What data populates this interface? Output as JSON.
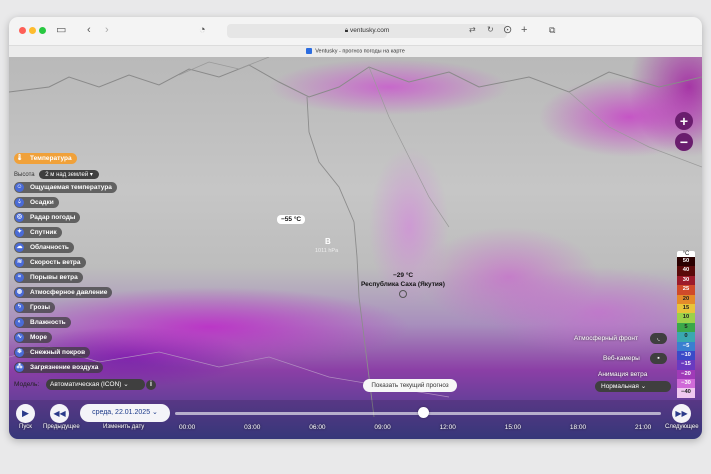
{
  "browser": {
    "address": "ventusky.com",
    "tab_title": "Ventusky - прогноз погоды на карте"
  },
  "layers": {
    "height_label": "Высота",
    "height_value": "2 м над землей",
    "items": [
      {
        "label": "Температура",
        "icon": "thermometer-icon",
        "active": true
      },
      {
        "label": "Ощущаемая температура",
        "icon": "feels-like-icon",
        "active": false
      },
      {
        "label": "Осадки",
        "icon": "drop-icon",
        "active": false
      },
      {
        "label": "Радар погоды",
        "icon": "radar-icon",
        "active": false
      },
      {
        "label": "Спутник",
        "icon": "satellite-icon",
        "active": false
      },
      {
        "label": "Облачность",
        "icon": "cloud-icon",
        "active": false
      },
      {
        "label": "Скорость ветра",
        "icon": "wind-icon",
        "active": false
      },
      {
        "label": "Порывы ветра",
        "icon": "gust-icon",
        "active": false
      },
      {
        "label": "Атмосферное давление",
        "icon": "pressure-icon",
        "active": false
      },
      {
        "label": "Грозы",
        "icon": "storm-icon",
        "active": false
      },
      {
        "label": "Влажность",
        "icon": "humidity-icon",
        "active": false
      },
      {
        "label": "Море",
        "icon": "wave-icon",
        "active": false
      },
      {
        "label": "Снежный покров",
        "icon": "snowflake-icon",
        "active": false
      },
      {
        "label": "Загрязнение воздуха",
        "icon": "pollution-icon",
        "active": false
      }
    ]
  },
  "model": {
    "label": "Модель:",
    "value": "Автоматическая (ICON)"
  },
  "map": {
    "temp_box": "−55 °C",
    "city_temp": "−29 °C",
    "region": "Республика Саха (Якутия)",
    "pressure_letter": "В",
    "pressure_value": "1011 hPa",
    "forecast_button": "Показать текущий прогноз"
  },
  "controls": {
    "fronts_label": "Атмосферный фронт",
    "webcams_label": "Веб-камеры",
    "animation_label": "Анимация ветра",
    "animation_value": "Нормальная"
  },
  "legend": {
    "unit": "°C",
    "values": [
      "50",
      "40",
      "30",
      "25",
      "20",
      "15",
      "10",
      "5",
      "0",
      "−5",
      "−10",
      "−15",
      "−20",
      "−30",
      "−40"
    ],
    "colors": [
      "#2a0000",
      "#5a0a0a",
      "#9c1b2a",
      "#d04a2a",
      "#e58a2a",
      "#e8c43a",
      "#9bd14a",
      "#3aa84a",
      "#3aa8b0",
      "#3a7fd0",
      "#3a4ac8",
      "#6a3ac0",
      "#a03ab8",
      "#d06ad8",
      "#f0c8f0"
    ]
  },
  "timeline": {
    "play_caption": "Пуск",
    "prev_caption": "Предыдущее",
    "change_date_caption": "Изменить дату",
    "next_caption": "Следующее",
    "date": "среда, 22.01.2025",
    "progress": 0.51,
    "times": [
      "00:00",
      "03:00",
      "06:00",
      "09:00",
      "12:00",
      "15:00",
      "18:00",
      "21:00"
    ]
  }
}
